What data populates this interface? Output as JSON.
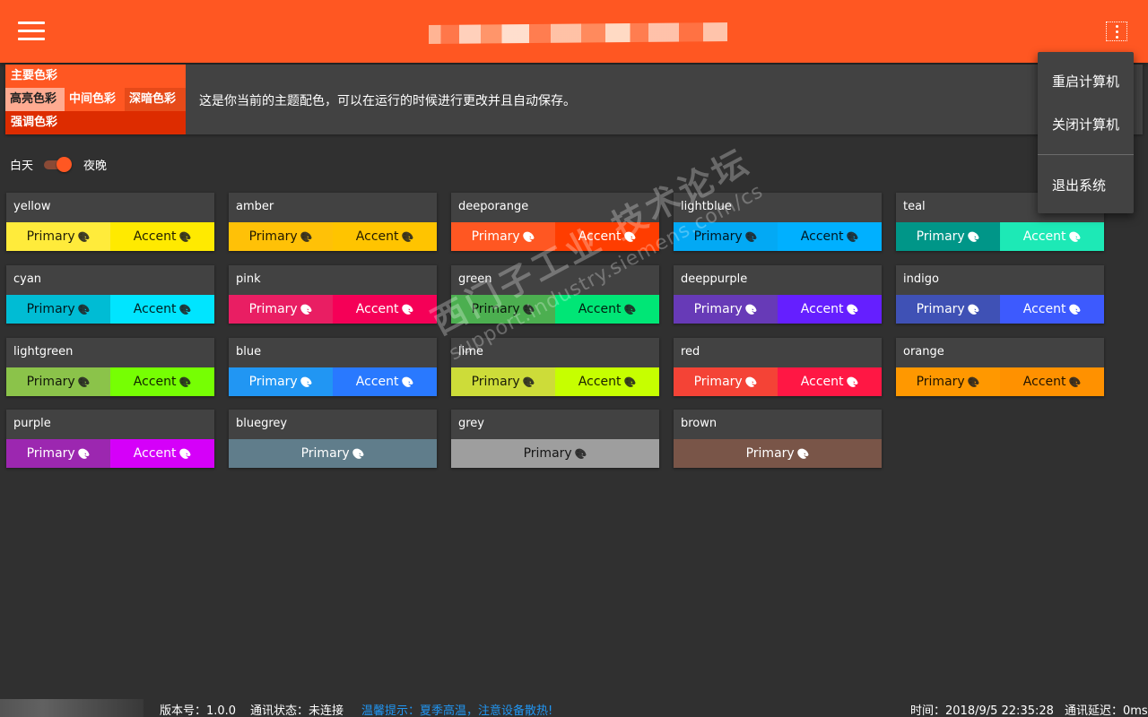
{
  "header": {
    "title": "",
    "menu_icon": "hamburger-menu-icon",
    "more_icon": "more-vertical-icon",
    "color": "#ff5722"
  },
  "menu": {
    "items": [
      "重启计算机",
      "关闭计算机",
      "退出系统"
    ]
  },
  "theme": {
    "primary_label": "主要色彩",
    "light_label": "高亮色彩",
    "mid_label": "中间色彩",
    "dark_label": "深暗色彩",
    "accent_label": "强调色彩",
    "description": "这是你当前的主题配色，可以在运行的时候进行更改并且自动保存。"
  },
  "mode": {
    "day_label": "白天",
    "night_label": "夜晚",
    "night_enabled": true
  },
  "palette_icon": "palette-icon",
  "swatches": [
    {
      "name": "yellow",
      "primary_label": "Primary",
      "accent_label": "Accent",
      "primary_color": "#ffeb3b",
      "accent_color": "#ffea00",
      "dark_text": true
    },
    {
      "name": "amber",
      "primary_label": "Primary",
      "accent_label": "Accent",
      "primary_color": "#ffc107",
      "accent_color": "#ffc400",
      "dark_text": true
    },
    {
      "name": "deeporange",
      "primary_label": "Primary",
      "accent_label": "Accent",
      "primary_color": "#ff5722",
      "accent_color": "#ff3d00",
      "dark_text": false
    },
    {
      "name": "lightblue",
      "primary_label": "Primary",
      "accent_label": "Accent",
      "primary_color": "#03a9f4",
      "accent_color": "#00b0ff",
      "dark_text": true
    },
    {
      "name": "teal",
      "primary_label": "Primary",
      "accent_label": "Accent",
      "primary_color": "#009688",
      "accent_color": "#1de9b6",
      "dark_text": false
    },
    {
      "name": "cyan",
      "primary_label": "Primary",
      "accent_label": "Accent",
      "primary_color": "#00bcd4",
      "accent_color": "#00e5ff",
      "dark_text": true
    },
    {
      "name": "pink",
      "primary_label": "Primary",
      "accent_label": "Accent",
      "primary_color": "#e91e63",
      "accent_color": "#f50057",
      "dark_text": false
    },
    {
      "name": "green",
      "primary_label": "Primary",
      "accent_label": "Accent",
      "primary_color": "#4caf50",
      "accent_color": "#00e676",
      "dark_text": true
    },
    {
      "name": "deeppurple",
      "primary_label": "Primary",
      "accent_label": "Accent",
      "primary_color": "#673ab7",
      "accent_color": "#651fff",
      "dark_text": false
    },
    {
      "name": "indigo",
      "primary_label": "Primary",
      "accent_label": "Accent",
      "primary_color": "#3f51b5",
      "accent_color": "#3d5afe",
      "dark_text": false
    },
    {
      "name": "lightgreen",
      "primary_label": "Primary",
      "accent_label": "Accent",
      "primary_color": "#8bc34a",
      "accent_color": "#76ff03",
      "dark_text": true
    },
    {
      "name": "blue",
      "primary_label": "Primary",
      "accent_label": "Accent",
      "primary_color": "#2196f3",
      "accent_color": "#2979ff",
      "dark_text": false
    },
    {
      "name": "lime",
      "primary_label": "Primary",
      "accent_label": "Accent",
      "primary_color": "#cddc39",
      "accent_color": "#c6ff00",
      "dark_text": true
    },
    {
      "name": "red",
      "primary_label": "Primary",
      "accent_label": "Accent",
      "primary_color": "#f44336",
      "accent_color": "#ff1744",
      "dark_text": false
    },
    {
      "name": "orange",
      "primary_label": "Primary",
      "accent_label": "Accent",
      "primary_color": "#ff9800",
      "accent_color": "#ff9100",
      "dark_text": true
    },
    {
      "name": "purple",
      "primary_label": "Primary",
      "accent_label": "Accent",
      "primary_color": "#9c27b0",
      "accent_color": "#d500f9",
      "dark_text": false
    },
    {
      "name": "bluegrey",
      "primary_label": "Primary",
      "primary_color": "#607d8b",
      "dark_text": false
    },
    {
      "name": "grey",
      "primary_label": "Primary",
      "primary_color": "#9e9e9e",
      "dark_text": true
    },
    {
      "name": "brown",
      "primary_label": "Primary",
      "primary_color": "#795548",
      "dark_text": false
    }
  ],
  "watermark": {
    "line1": "西门子工业 技术论坛",
    "line2": "support.industry.siemens.com/cs"
  },
  "status": {
    "version": "版本号：1.0.0",
    "comm_status": "通讯状态：未连接",
    "tip": "温馨提示：夏季高温，注意设备散热!",
    "time": "时间：2018/9/5 22:35:28",
    "delay": "通讯延迟：0ms"
  }
}
